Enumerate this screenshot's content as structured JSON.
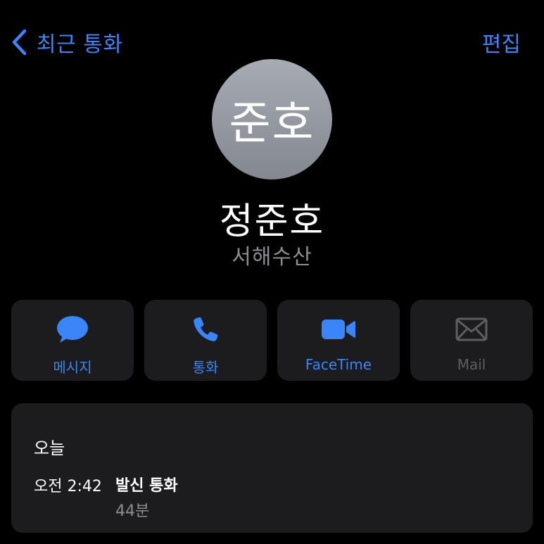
{
  "nav": {
    "back_label": "최근 통화",
    "edit_label": "편집"
  },
  "contact": {
    "initials": "준호",
    "name": "정준호",
    "company": "서해수산"
  },
  "actions": [
    {
      "label": "메시지",
      "icon": "message-bubble-icon",
      "enabled": true
    },
    {
      "label": "통화",
      "icon": "phone-icon",
      "enabled": true
    },
    {
      "label": "FaceTime",
      "icon": "video-camera-icon",
      "enabled": true
    },
    {
      "label": "Mail",
      "icon": "envelope-icon",
      "enabled": false
    }
  ],
  "recent_call": {
    "day": "오늘",
    "time": "오전 2:42",
    "type": "발신 통화",
    "duration": "44분"
  },
  "colors": {
    "accent": "#3a85f7",
    "background": "#000000",
    "card": "#1c1c1e",
    "secondary_text": "#8d8d93",
    "disabled": "#5d5d62"
  }
}
